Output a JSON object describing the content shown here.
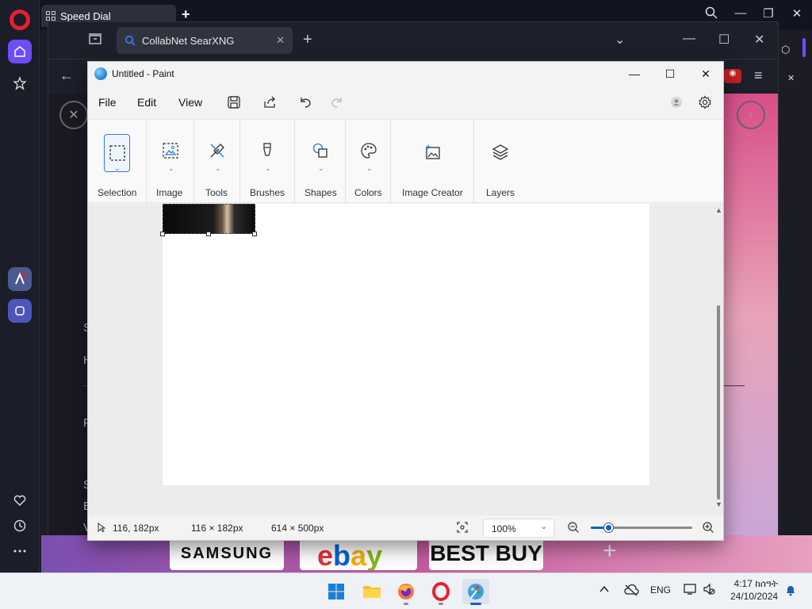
{
  "opera": {
    "tab_title": "Speed Dial",
    "new_tab_label": "+"
  },
  "browser2": {
    "tab_title": "CollabNet SearXNG",
    "new_tab_label": "+",
    "side_letters": [
      "S",
      "H",
      "F",
      "S",
      "E",
      "V"
    ]
  },
  "speed_dial": {
    "tiles": [
      "SAMSUNG",
      "ebay",
      "BEST BUY"
    ],
    "add_label": "+"
  },
  "paint": {
    "title": "Untitled - Paint",
    "menu": [
      "File",
      "Edit",
      "View"
    ],
    "ribbon": {
      "selection": "Selection",
      "image": "Image",
      "tools": "Tools",
      "brushes": "Brushes",
      "shapes": "Shapes",
      "colors": "Colors",
      "image_creator": "Image Creator",
      "layers": "Layers"
    },
    "status": {
      "cursor_pos": "116, 182px",
      "selection_size": "116 × 182px",
      "canvas_size": "614 × 500px",
      "zoom": "100%",
      "zoom_fraction": 0.17
    }
  },
  "taskbar": {
    "language": "ENG",
    "time": "4:17 ከሰዓት",
    "date": "24/10/2024"
  },
  "colors": {
    "accent": "#1a5fb4",
    "opera_red": "#e8202c",
    "opera_purple": "#6c4df6"
  }
}
